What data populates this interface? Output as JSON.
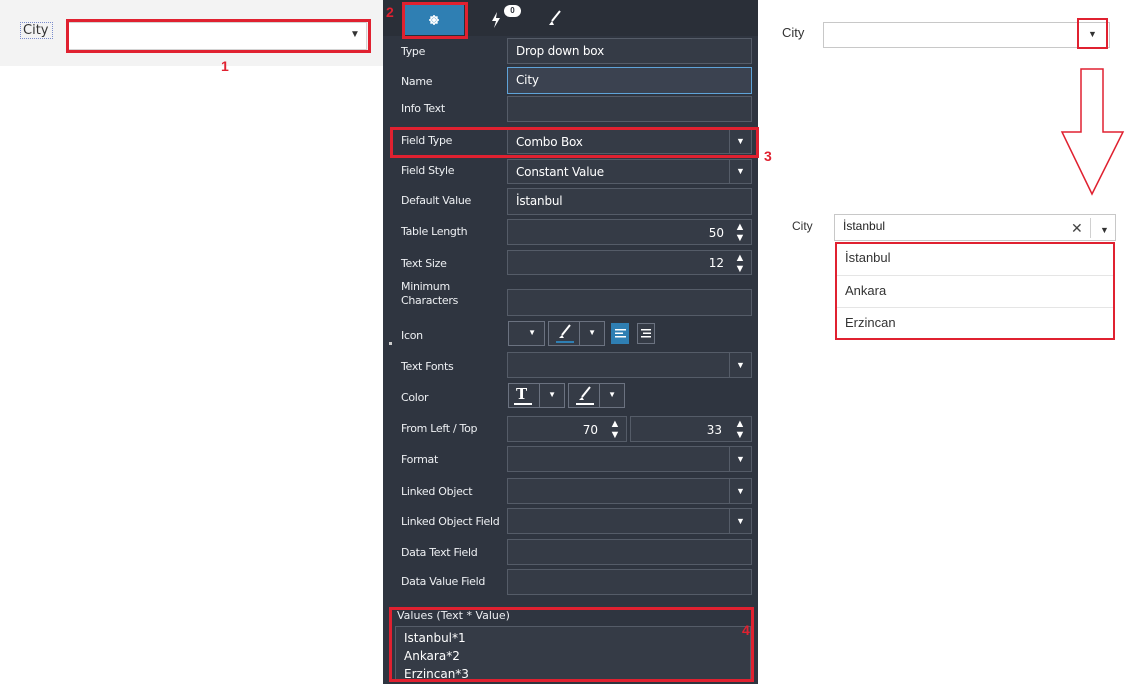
{
  "left_form": {
    "label": "City",
    "dropdown_arrow": "▼"
  },
  "annotations": {
    "n1": "1",
    "n2": "2",
    "n3": "3",
    "n4": "4"
  },
  "tabs": {
    "events_badge": "0"
  },
  "properties": {
    "type": {
      "label": "Type",
      "value": "Drop down box"
    },
    "name": {
      "label": "Name",
      "value": "City"
    },
    "info_text": {
      "label": "Info Text",
      "value": ""
    },
    "field_type": {
      "label": "Field Type",
      "value": "Combo Box"
    },
    "field_style": {
      "label": "Field Style",
      "value": "Constant Value"
    },
    "default_value": {
      "label": "Default Value",
      "value": "İstanbul"
    },
    "table_length": {
      "label": "Table Length",
      "value": "50"
    },
    "text_size": {
      "label": "Text Size",
      "value": "12"
    },
    "min_chars": {
      "label": "Minimum Characters",
      "value": ""
    },
    "icon": {
      "label": "Icon"
    },
    "text_fonts": {
      "label": "Text Fonts",
      "value": ""
    },
    "color": {
      "label": "Color",
      "text_glyph": "T"
    },
    "from_left_top": {
      "label": "From Left / Top",
      "left": "70",
      "top": "33"
    },
    "format": {
      "label": "Format",
      "value": ""
    },
    "linked_object": {
      "label": "Linked Object",
      "value": ""
    },
    "linked_object_field": {
      "label": "Linked Object Field",
      "value": ""
    },
    "data_text_field": {
      "label": "Data Text Field",
      "value": ""
    },
    "data_value_field": {
      "label": "Data Value Field",
      "value": ""
    },
    "values": {
      "label": "Values (Text * Value)",
      "lines": [
        "Istanbul*1",
        "Ankara*2",
        "Erzincan*3"
      ]
    }
  },
  "preview_closed": {
    "label": "City"
  },
  "preview_open": {
    "label": "City",
    "input_value": "İstanbul",
    "clear_glyph": "✕",
    "options": [
      "İstanbul",
      "Ankara",
      "Erzincan"
    ]
  },
  "colors": {
    "accent_blue": "#2f7fb3",
    "annotation_red": "#e02130",
    "panel_bg": "#2f3540"
  }
}
